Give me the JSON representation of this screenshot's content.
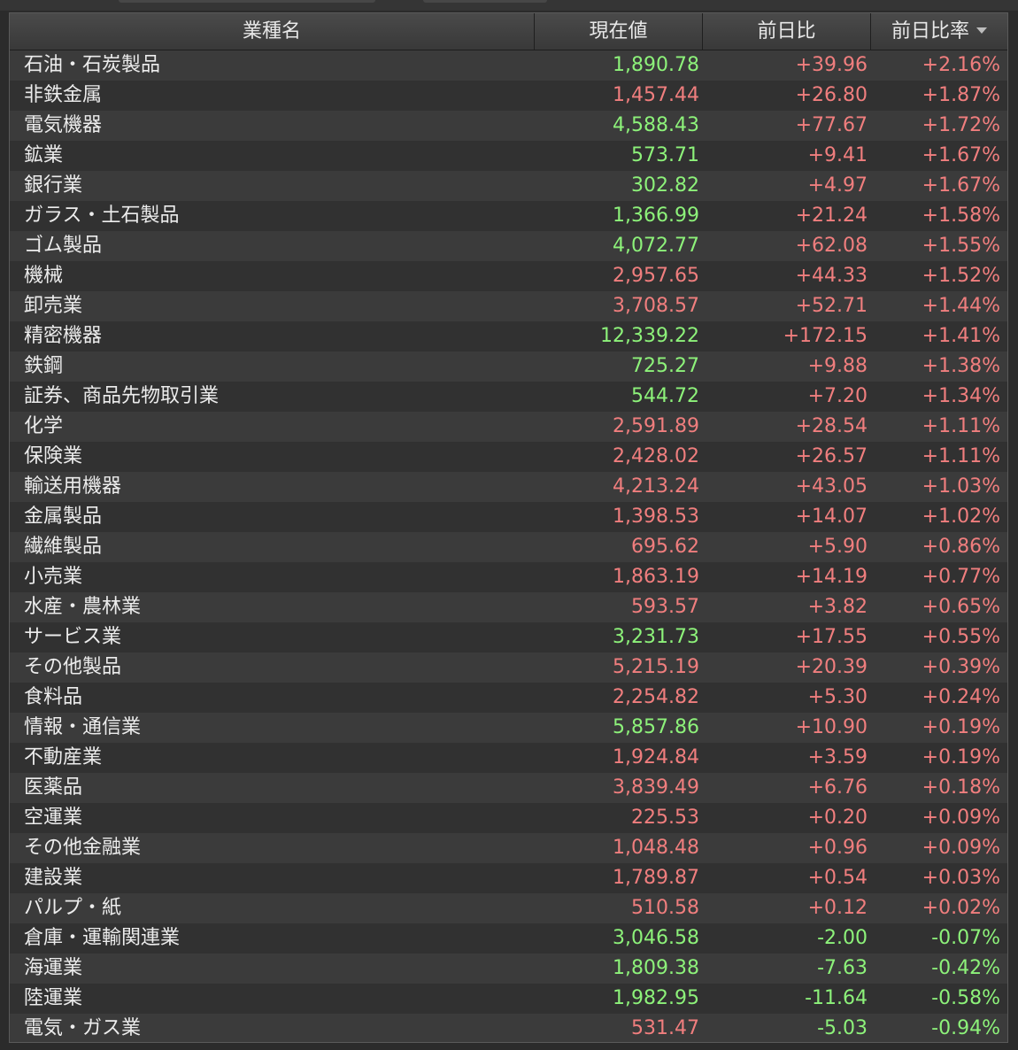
{
  "header": {
    "name": "業種名",
    "price": "現在値",
    "change": "前日比",
    "change_pct": "前日比率"
  },
  "colors": {
    "up_price": "#8df27a",
    "down_price": "#f07e7e",
    "plus_change": "#f07e7e",
    "minus_change": "#8df27a"
  },
  "rows": [
    {
      "name": "石油・石炭製品",
      "price": "1,890.78",
      "price_dir": "up",
      "change": "+39.96",
      "change_pct": "+2.16%"
    },
    {
      "name": "非鉄金属",
      "price": "1,457.44",
      "price_dir": "down",
      "change": "+26.80",
      "change_pct": "+1.87%"
    },
    {
      "name": "電気機器",
      "price": "4,588.43",
      "price_dir": "up",
      "change": "+77.67",
      "change_pct": "+1.72%"
    },
    {
      "name": "鉱業",
      "price": "573.71",
      "price_dir": "up",
      "change": "+9.41",
      "change_pct": "+1.67%"
    },
    {
      "name": "銀行業",
      "price": "302.82",
      "price_dir": "up",
      "change": "+4.97",
      "change_pct": "+1.67%"
    },
    {
      "name": "ガラス・土石製品",
      "price": "1,366.99",
      "price_dir": "up",
      "change": "+21.24",
      "change_pct": "+1.58%"
    },
    {
      "name": "ゴム製品",
      "price": "4,072.77",
      "price_dir": "up",
      "change": "+62.08",
      "change_pct": "+1.55%"
    },
    {
      "name": "機械",
      "price": "2,957.65",
      "price_dir": "down",
      "change": "+44.33",
      "change_pct": "+1.52%"
    },
    {
      "name": "卸売業",
      "price": "3,708.57",
      "price_dir": "down",
      "change": "+52.71",
      "change_pct": "+1.44%"
    },
    {
      "name": "精密機器",
      "price": "12,339.22",
      "price_dir": "up",
      "change": "+172.15",
      "change_pct": "+1.41%"
    },
    {
      "name": "鉄鋼",
      "price": "725.27",
      "price_dir": "up",
      "change": "+9.88",
      "change_pct": "+1.38%"
    },
    {
      "name": "証券、商品先物取引業",
      "price": "544.72",
      "price_dir": "up",
      "change": "+7.20",
      "change_pct": "+1.34%"
    },
    {
      "name": "化学",
      "price": "2,591.89",
      "price_dir": "down",
      "change": "+28.54",
      "change_pct": "+1.11%"
    },
    {
      "name": "保険業",
      "price": "2,428.02",
      "price_dir": "down",
      "change": "+26.57",
      "change_pct": "+1.11%"
    },
    {
      "name": "輸送用機器",
      "price": "4,213.24",
      "price_dir": "down",
      "change": "+43.05",
      "change_pct": "+1.03%"
    },
    {
      "name": "金属製品",
      "price": "1,398.53",
      "price_dir": "down",
      "change": "+14.07",
      "change_pct": "+1.02%"
    },
    {
      "name": "繊維製品",
      "price": "695.62",
      "price_dir": "down",
      "change": "+5.90",
      "change_pct": "+0.86%"
    },
    {
      "name": "小売業",
      "price": "1,863.19",
      "price_dir": "down",
      "change": "+14.19",
      "change_pct": "+0.77%"
    },
    {
      "name": "水産・農林業",
      "price": "593.57",
      "price_dir": "down",
      "change": "+3.82",
      "change_pct": "+0.65%"
    },
    {
      "name": "サービス業",
      "price": "3,231.73",
      "price_dir": "up",
      "change": "+17.55",
      "change_pct": "+0.55%"
    },
    {
      "name": "その他製品",
      "price": "5,215.19",
      "price_dir": "down",
      "change": "+20.39",
      "change_pct": "+0.39%"
    },
    {
      "name": "食料品",
      "price": "2,254.82",
      "price_dir": "down",
      "change": "+5.30",
      "change_pct": "+0.24%"
    },
    {
      "name": "情報・通信業",
      "price": "5,857.86",
      "price_dir": "up",
      "change": "+10.90",
      "change_pct": "+0.19%"
    },
    {
      "name": "不動産業",
      "price": "1,924.84",
      "price_dir": "down",
      "change": "+3.59",
      "change_pct": "+0.19%"
    },
    {
      "name": "医薬品",
      "price": "3,839.49",
      "price_dir": "down",
      "change": "+6.76",
      "change_pct": "+0.18%"
    },
    {
      "name": "空運業",
      "price": "225.53",
      "price_dir": "down",
      "change": "+0.20",
      "change_pct": "+0.09%"
    },
    {
      "name": "その他金融業",
      "price": "1,048.48",
      "price_dir": "down",
      "change": "+0.96",
      "change_pct": "+0.09%"
    },
    {
      "name": "建設業",
      "price": "1,789.87",
      "price_dir": "down",
      "change": "+0.54",
      "change_pct": "+0.03%"
    },
    {
      "name": "パルプ・紙",
      "price": "510.58",
      "price_dir": "down",
      "change": "+0.12",
      "change_pct": "+0.02%"
    },
    {
      "name": "倉庫・運輸関連業",
      "price": "3,046.58",
      "price_dir": "up",
      "change": "-2.00",
      "change_pct": "-0.07%"
    },
    {
      "name": "海運業",
      "price": "1,809.38",
      "price_dir": "up",
      "change": "-7.63",
      "change_pct": "-0.42%"
    },
    {
      "name": "陸運業",
      "price": "1,982.95",
      "price_dir": "up",
      "change": "-11.64",
      "change_pct": "-0.58%"
    },
    {
      "name": "電気・ガス業",
      "price": "531.47",
      "price_dir": "down",
      "change": "-5.03",
      "change_pct": "-0.94%"
    }
  ]
}
